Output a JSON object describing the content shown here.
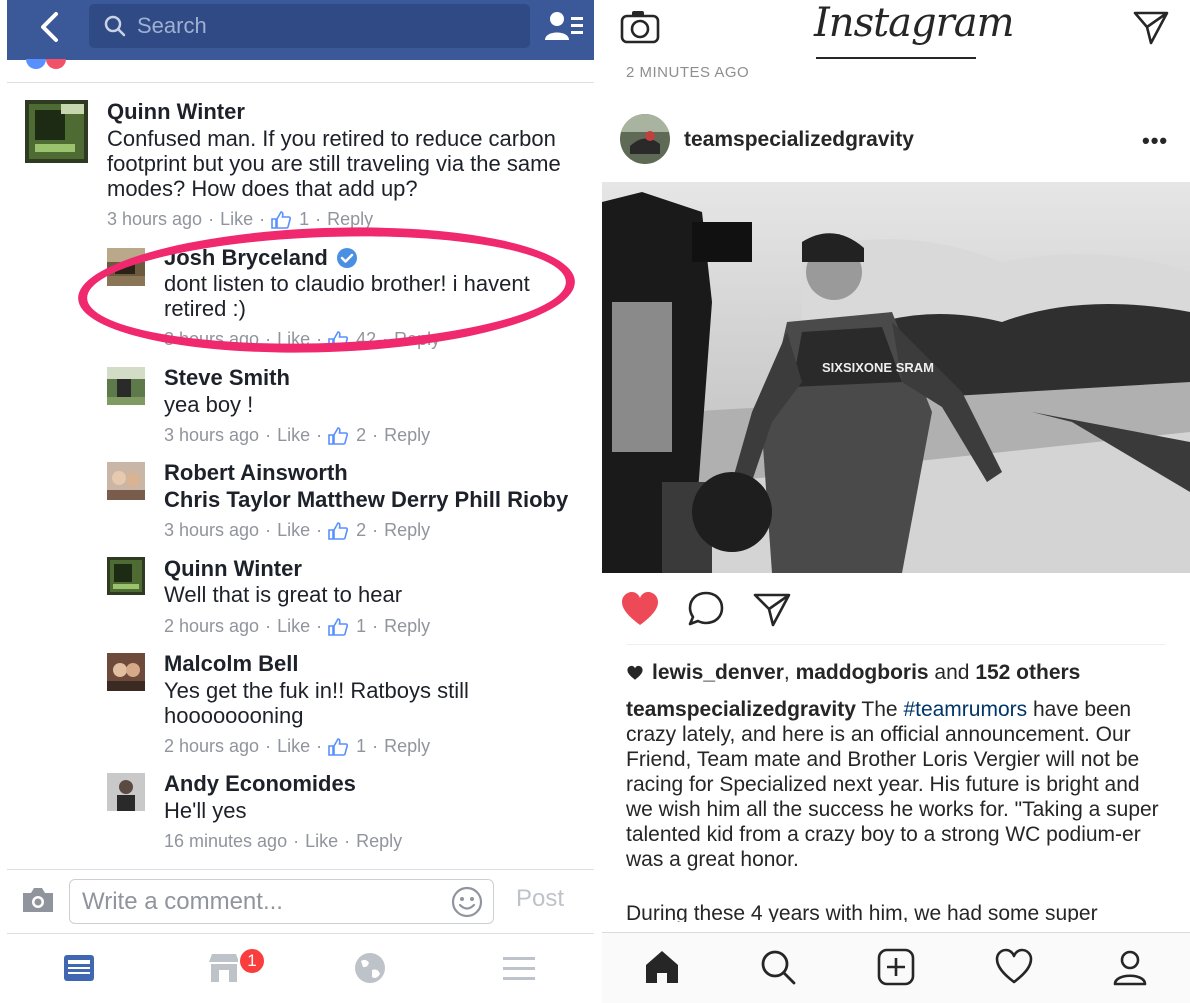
{
  "facebook": {
    "search_placeholder": "Search",
    "comments": [
      {
        "name": "Quinn Winter",
        "text": "Confused man. If you retired to reduce carbon footprint but you are still traveling via the same modes? How does that add up?",
        "time": "3 hours ago",
        "like": "Like",
        "likes": "1",
        "reply": "Reply"
      },
      {
        "name": "Josh Bryceland",
        "verified": true,
        "text": "dont listen to claudio brother! i havent retired :)",
        "time": "3 hours ago",
        "like": "Like",
        "likes": "42",
        "reply": "Reply"
      },
      {
        "name": "Steve Smith",
        "text": "yea boy !",
        "time": "3 hours ago",
        "like": "Like",
        "likes": "2",
        "reply": "Reply"
      },
      {
        "name": "Robert Ainsworth",
        "text": "Chris Taylor Matthew Derry Phill Rioby",
        "time": "3 hours ago",
        "like": "Like",
        "likes": "2",
        "reply": "Reply"
      },
      {
        "name": "Quinn Winter",
        "text": "Well that is great to hear",
        "time": "2 hours ago",
        "like": "Like",
        "likes": "1",
        "reply": "Reply"
      },
      {
        "name": "Malcolm Bell",
        "text": "Yes get the fuk in!! Ratboys still hoooooooning",
        "time": "2 hours ago",
        "like": "Like",
        "likes": "1",
        "reply": "Reply"
      },
      {
        "name": "Andy Economides",
        "text": "He'll yes",
        "time": "16 minutes ago",
        "like": "Like",
        "reply": "Reply"
      }
    ],
    "compose_placeholder": "Write a comment...",
    "post_label": "Post",
    "notification_badge": "1",
    "nav_icons": [
      "news-feed-icon",
      "marketplace-icon",
      "globe-icon",
      "menu-icon"
    ],
    "brand_color": "#3b5998",
    "highlight_color": "#f0286e"
  },
  "instagram": {
    "logo": "Instagram",
    "timestamp": "2 MINUTES AGO",
    "username": "teamspecializedgravity",
    "more": "•••",
    "liked_by_1": "lewis_denver",
    "liked_by_sep": ", ",
    "liked_by_2": "maddogboris",
    "liked_by_and": " and ",
    "liked_by_count": "152 others",
    "caption_user": "teamspecializedgravity",
    "caption_pre": " The ",
    "caption_tag": "#teamrumors",
    "caption_body": " have been crazy lately, and here is an official announcement. Our Friend, Team mate and Brother Loris Vergier will not be racing for Specialized next year. His future is bright and we wish him all the success he works for. \"Taking a super talented kid from a crazy boy to a strong WC podium-er was a great honor.",
    "caption_cont": "During these 4 years with him, we had some super",
    "photo_text_jersey": "SIXSIXONE SRAM",
    "heart_color": "#ed4956",
    "nav_icons": [
      "home-icon",
      "search-icon",
      "add-post-icon",
      "activity-heart-icon",
      "profile-icon"
    ]
  }
}
